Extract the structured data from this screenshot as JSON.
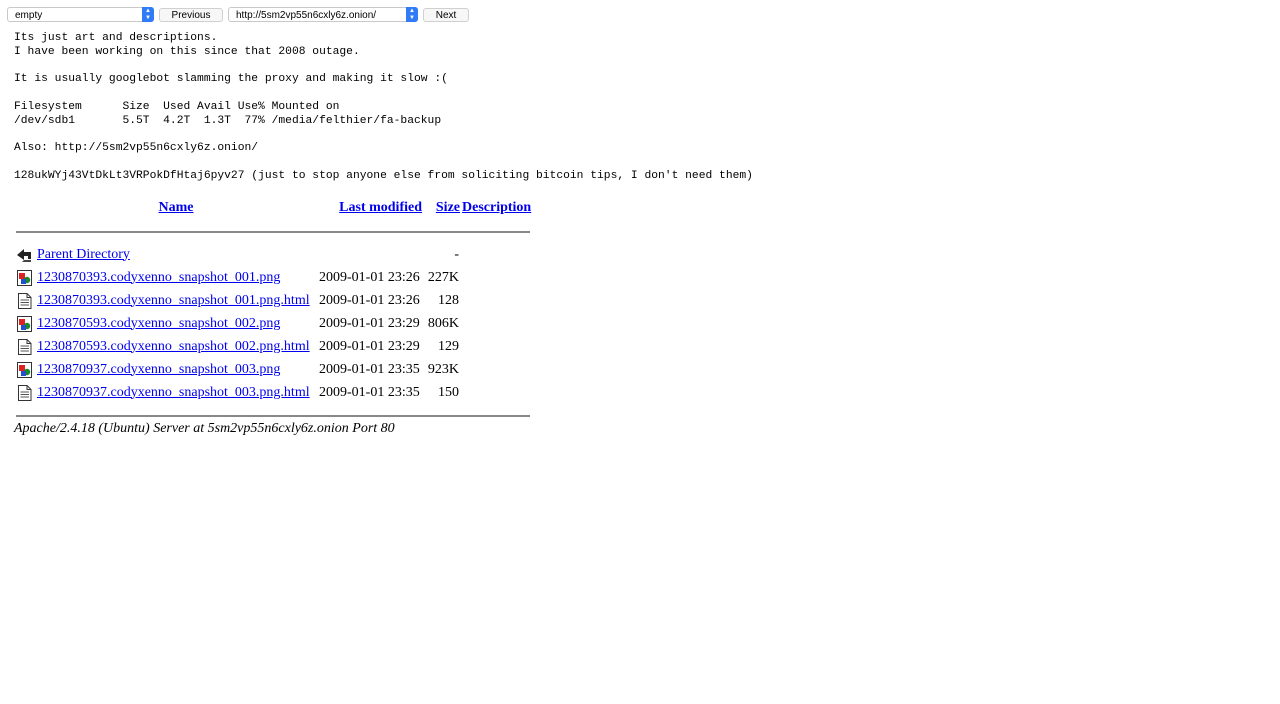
{
  "toolbar": {
    "profile_select_value": "empty",
    "previous_label": "Previous",
    "url_select_value": "http://5sm2vp55n6cxly6z.onion/",
    "next_label": "Next"
  },
  "intro_lines": [
    "Its just art and descriptions.",
    "I have been working on this since that 2008 outage.",
    "",
    "It is usually googlebot slamming the proxy and making it slow :(",
    "",
    "Filesystem      Size  Used Avail Use% Mounted on",
    "/dev/sdb1       5.5T  4.2T  1.3T  77% /media/felthier/fa-backup",
    "",
    "Also: http://5sm2vp55n6cxly6z.onion/",
    "",
    "128ukWYj43VtDkLt3VRPokDfHtaj6pyv27 (just to stop anyone else from soliciting bitcoin tips, I don't need them)"
  ],
  "table": {
    "headers": {
      "name": "Name",
      "last_modified": "Last modified",
      "size": "Size",
      "description": "Description"
    },
    "parent": {
      "name": "Parent Directory",
      "size": "-"
    },
    "rows": [
      {
        "name": "1230870393.codyxenno_snapshot_001.png",
        "modified": "2009-01-01 23:26",
        "size": "227K",
        "icon": "image-icon"
      },
      {
        "name": "1230870393.codyxenno_snapshot_001.png.html",
        "modified": "2009-01-01 23:26",
        "size": "128",
        "icon": "text-file-icon"
      },
      {
        "name": "1230870593.codyxenno_snapshot_002.png",
        "modified": "2009-01-01 23:29",
        "size": "806K",
        "icon": "image-icon"
      },
      {
        "name": "1230870593.codyxenno_snapshot_002.png.html",
        "modified": "2009-01-01 23:29",
        "size": "129",
        "icon": "text-file-icon"
      },
      {
        "name": "1230870937.codyxenno_snapshot_003.png",
        "modified": "2009-01-01 23:35",
        "size": "923K",
        "icon": "image-icon"
      },
      {
        "name": "1230870937.codyxenno_snapshot_003.png.html",
        "modified": "2009-01-01 23:35",
        "size": "150",
        "icon": "text-file-icon"
      }
    ]
  },
  "footer": {
    "address": "Apache/2.4.18 (Ubuntu) Server at 5sm2vp55n6cxly6z.onion Port 80"
  },
  "colors": {
    "link": "#0000ee",
    "select_arrow": "#2f7cf6"
  }
}
